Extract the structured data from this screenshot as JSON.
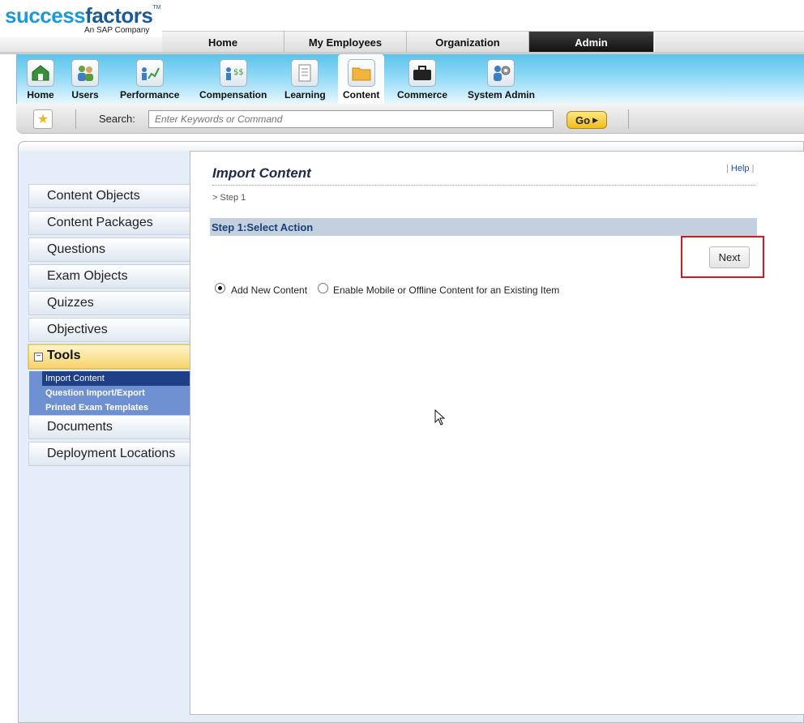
{
  "logo": {
    "word_part1": "success",
    "word_part2": "factors",
    "tagline": "An SAP Company"
  },
  "top_tabs": [
    "Home",
    "My Employees",
    "Organization",
    "Admin"
  ],
  "modules": [
    {
      "label": "Home",
      "icon": "home-icon"
    },
    {
      "label": "Users",
      "icon": "users-icon"
    },
    {
      "label": "Performance",
      "icon": "performance-icon"
    },
    {
      "label": "Compensation",
      "icon": "compensation-icon"
    },
    {
      "label": "Learning",
      "icon": "learning-icon"
    },
    {
      "label": "Content",
      "icon": "content-folder-icon"
    },
    {
      "label": "Commerce",
      "icon": "commerce-briefcase-icon"
    },
    {
      "label": "System Admin",
      "icon": "system-admin-icon"
    }
  ],
  "search": {
    "label": "Search:",
    "placeholder": "Enter Keywords or Command",
    "go_label": "Go"
  },
  "nav": {
    "items_top": [
      "Content Objects",
      "Content Packages",
      "Questions",
      "Exam Objects",
      "Quizzes",
      "Objectives"
    ],
    "tools_label": "Tools",
    "tools_sub": [
      "Import Content",
      "Question Import/Export",
      "Printed Exam Templates"
    ],
    "items_bottom": [
      "Documents",
      "Deployment Locations"
    ]
  },
  "page": {
    "title": "Import Content",
    "help_label": "Help",
    "breadcrumb": "> Step 1",
    "step_heading": "Step 1:Select Action",
    "next_label": "Next",
    "options": [
      {
        "label": "Add New Content",
        "selected": true
      },
      {
        "label": "Enable Mobile or Offline Content for an Existing Item",
        "selected": false
      }
    ]
  },
  "colors": {
    "logo_blue": "#1a9ad6",
    "module_bar": "#5cc3ec",
    "step_bar": "#c3d0df",
    "highlight_box": "#e0151c",
    "subnav_selected": "#1f3f86"
  }
}
